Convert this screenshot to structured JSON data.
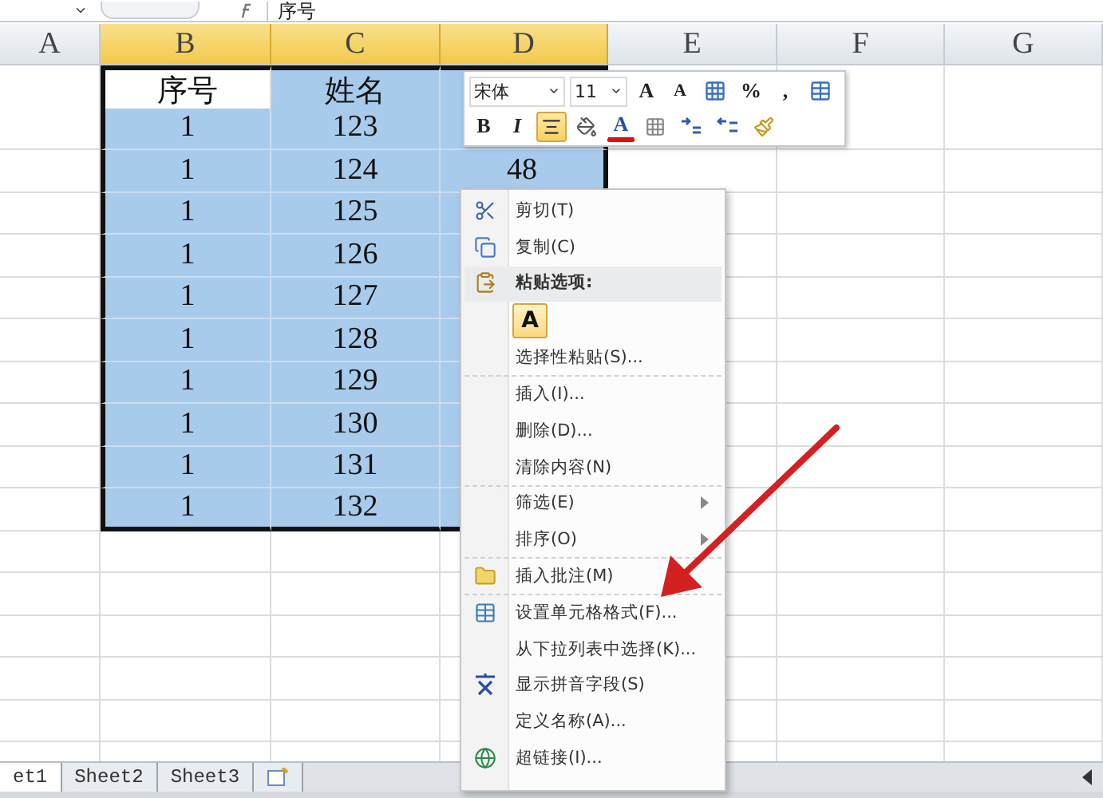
{
  "formula_bar": {
    "value": "序号"
  },
  "columns": [
    {
      "label": "A",
      "selected": false
    },
    {
      "label": "B",
      "selected": true
    },
    {
      "label": "C",
      "selected": true
    },
    {
      "label": "D",
      "selected": true
    },
    {
      "label": "E",
      "selected": false
    },
    {
      "label": "F",
      "selected": false
    },
    {
      "label": "G",
      "selected": false
    }
  ],
  "rows": [
    {
      "cells": [
        {
          "text": "序号",
          "selected": false
        },
        {
          "text": "姓名",
          "selected": true
        },
        {
          "selected": true
        }
      ]
    },
    {
      "cells": [
        {
          "text": "1",
          "selected": true
        },
        {
          "text": "123",
          "selected": true
        },
        {
          "selected": true
        }
      ]
    },
    {
      "cells": [
        {
          "text": "1",
          "selected": true
        },
        {
          "text": "124",
          "selected": true
        },
        {
          "text": "48",
          "selected": true
        }
      ]
    },
    {
      "cells": [
        {
          "text": "1",
          "selected": true
        },
        {
          "text": "125",
          "selected": true
        },
        {
          "selected": true
        }
      ]
    },
    {
      "cells": [
        {
          "text": "1",
          "selected": true
        },
        {
          "text": "126",
          "selected": true
        },
        {
          "selected": true
        }
      ]
    },
    {
      "cells": [
        {
          "text": "1",
          "selected": true
        },
        {
          "text": "127",
          "selected": true
        },
        {
          "selected": true
        }
      ]
    },
    {
      "cells": [
        {
          "text": "1",
          "selected": true
        },
        {
          "text": "128",
          "selected": true
        },
        {
          "selected": true
        }
      ]
    },
    {
      "cells": [
        {
          "text": "1",
          "selected": true
        },
        {
          "text": "129",
          "selected": true
        },
        {
          "selected": true
        }
      ]
    },
    {
      "cells": [
        {
          "text": "1",
          "selected": true
        },
        {
          "text": "130",
          "selected": true
        },
        {
          "selected": true
        }
      ]
    },
    {
      "cells": [
        {
          "text": "1",
          "selected": true
        },
        {
          "text": "131",
          "selected": true
        },
        {
          "selected": true
        }
      ]
    },
    {
      "cells": [
        {
          "text": "1",
          "selected": true
        },
        {
          "text": "132",
          "selected": true
        },
        {
          "selected": true
        }
      ]
    }
  ],
  "mini_toolbar": {
    "font": "宋体",
    "size": "11",
    "row1": [
      {
        "kind": "grow",
        "label": "A",
        "selected": false
      },
      {
        "kind": "shrink",
        "label": "A",
        "selected": false
      },
      {
        "kind": "styles",
        "selected": false
      },
      {
        "kind": "text",
        "label": "%",
        "selected": false
      },
      {
        "kind": "text",
        "label": ",",
        "selected": false
      },
      {
        "kind": "merge",
        "selected": false
      }
    ],
    "row2": [
      {
        "kind": "bold",
        "label": "B",
        "selected": false
      },
      {
        "kind": "italic",
        "label": "I",
        "selected": false
      },
      {
        "kind": "align",
        "selected": true
      },
      {
        "kind": "fill",
        "selected": false
      },
      {
        "kind": "fontcolor",
        "label": "A",
        "selected": false
      },
      {
        "kind": "border",
        "selected": false
      },
      {
        "kind": "incdec",
        "selected": false
      },
      {
        "kind": "decdec",
        "selected": false
      },
      {
        "kind": "brush",
        "selected": false
      }
    ]
  },
  "context_menu": [
    {
      "kind": "cut",
      "label": "剪切(T)",
      "submenu": false,
      "separator_after": false
    },
    {
      "kind": "copy",
      "label": "复制(C)",
      "submenu": false,
      "separator_after": false
    },
    {
      "kind": "paste-header",
      "label": "粘贴选项:",
      "submenu": false,
      "separator_after": false
    },
    {
      "kind": "paste-button",
      "label": "A",
      "submenu": false,
      "separator_after": false
    },
    {
      "kind": "plain",
      "label": "选择性粘贴(S)...",
      "submenu": false,
      "separator_after": true
    },
    {
      "kind": "plain",
      "label": "插入(I)...",
      "submenu": false,
      "separator_after": false
    },
    {
      "kind": "plain",
      "label": "删除(D)...",
      "submenu": false,
      "separator_after": false
    },
    {
      "kind": "plain",
      "label": "清除内容(N)",
      "submenu": false,
      "separator_after": true
    },
    {
      "kind": "plain",
      "label": "筛选(E)",
      "submenu": true,
      "separator_after": false
    },
    {
      "kind": "plain",
      "label": "排序(O)",
      "submenu": true,
      "separator_after": true
    },
    {
      "kind": "comment",
      "label": "插入批注(M)",
      "submenu": false,
      "separator_after": true
    },
    {
      "kind": "format",
      "label": "设置单元格格式(F)...",
      "submenu": false,
      "separator_after": false
    },
    {
      "kind": "plain",
      "label": "从下拉列表中选择(K)...",
      "submenu": false,
      "separator_after": false
    },
    {
      "kind": "phonetic",
      "label": "显示拼音字段(S)",
      "submenu": false,
      "separator_after": false
    },
    {
      "kind": "plain",
      "label": "定义名称(A)...",
      "submenu": false,
      "separator_after": false
    },
    {
      "kind": "link",
      "label": "超链接(I)...",
      "submenu": false,
      "separator_after": false
    }
  ],
  "sheet_tabs": [
    {
      "label": "et1",
      "selected": true
    },
    {
      "label": "Sheet2",
      "selected": false
    },
    {
      "label": "Sheet3",
      "selected": false
    }
  ]
}
